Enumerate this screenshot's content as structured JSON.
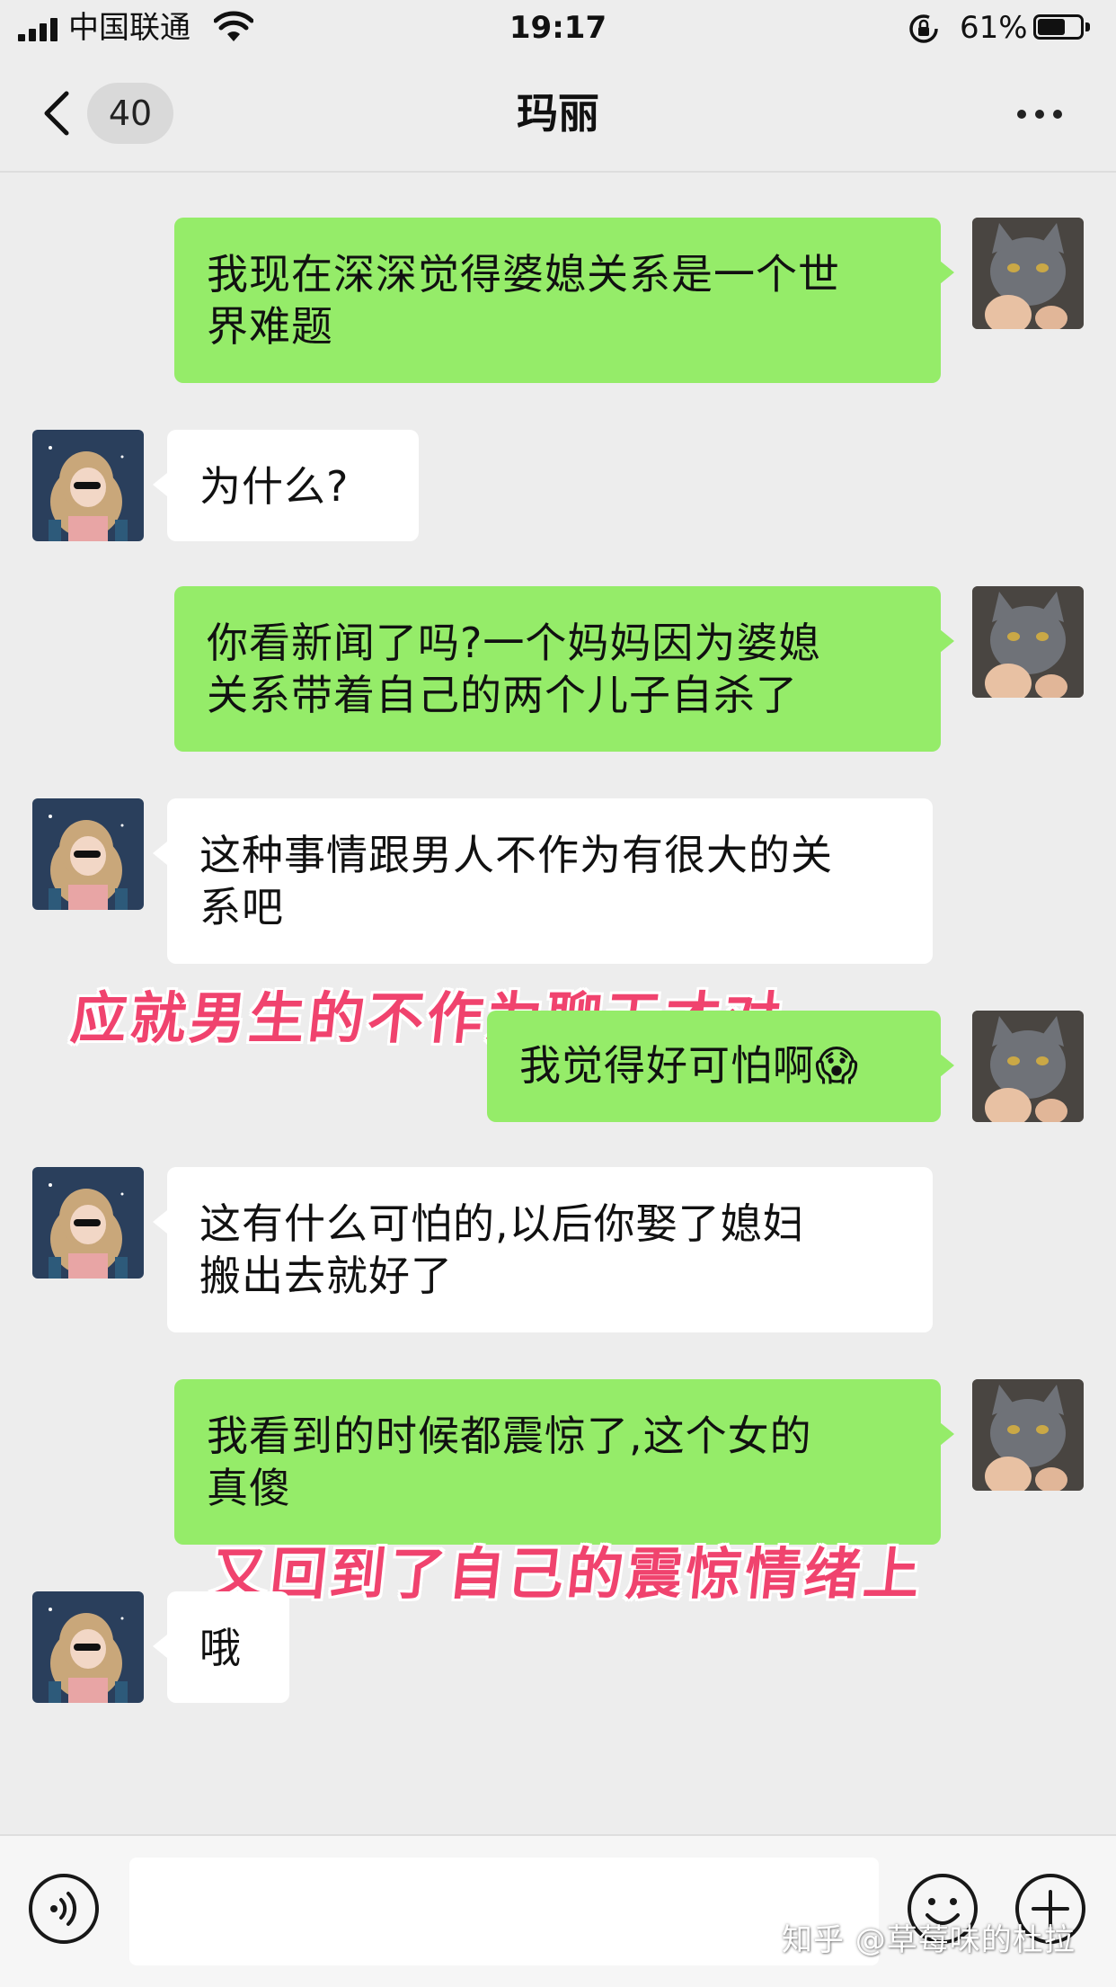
{
  "status_bar": {
    "carrier": "中国联通",
    "time": "19:17",
    "battery": "61%"
  },
  "nav": {
    "unread_count": "40",
    "title": "玛丽"
  },
  "messages": [
    {
      "sender": "me",
      "text_lines": [
        "我现在深深觉得婆媳关系是一个世",
        "界难题"
      ]
    },
    {
      "sender": "them",
      "text_lines": [
        "为什么?"
      ]
    },
    {
      "sender": "me",
      "text_lines": [
        "你看新闻了吗?一个妈妈因为婆媳",
        "关系带着自己的两个儿子自杀了"
      ]
    },
    {
      "sender": "them",
      "text_lines": [
        "这种事情跟男人不作为有很大的关",
        "系吧"
      ]
    },
    {
      "sender": "me",
      "text_lines": [
        "我觉得好可怕啊😱"
      ]
    },
    {
      "sender": "them",
      "text_lines": [
        "这有什么可怕的,以后你娶了媳妇",
        "搬出去就好了"
      ]
    },
    {
      "sender": "me",
      "text_lines": [
        "我看到的时候都震惊了,这个女的",
        "真傻"
      ]
    },
    {
      "sender": "them",
      "text_lines": [
        "哦"
      ]
    }
  ],
  "overlays": {
    "annotation_1": "应就男生的不作为聊天才对",
    "annotation_2": "又回到了自己的震惊情绪上"
  },
  "input_bar": {
    "value": ""
  },
  "watermark": "知乎 @草莓味的杜拉",
  "colors": {
    "background": "#EDEDED",
    "my_bubble": "#95EC69",
    "their_bubble": "#FFFFFF",
    "annotation": "#F0436E"
  },
  "icons": [
    "back-icon",
    "more-icon",
    "voice-icon",
    "emoji-icon",
    "plus-icon",
    "signal-icon",
    "wifi-icon",
    "battery-icon",
    "lock-icon"
  ]
}
